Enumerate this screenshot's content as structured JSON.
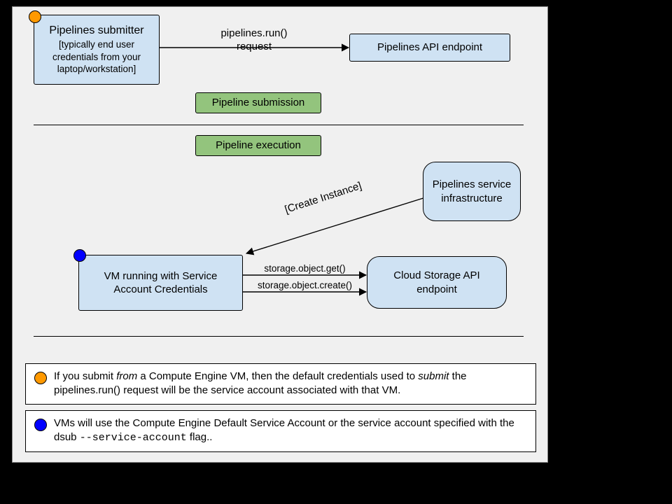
{
  "boxes": {
    "submitter_title": "Pipelines submitter",
    "submitter_sub": "[typically end user credentials from your laptop/workstation]",
    "api_endpoint": "Pipelines API endpoint",
    "vm": "VM running with Service Account Credentials",
    "storage": "Cloud Storage API endpoint",
    "service_infra": "Pipelines service infrastructure"
  },
  "phases": {
    "submission": "Pipeline submission",
    "execution": "Pipeline execution"
  },
  "edges": {
    "run_top": "pipelines.run()",
    "run_bot": "request",
    "create": "[Create Instance]",
    "get": "storage.object.get()",
    "create_obj": "storage.object.create()"
  },
  "notes": {
    "orange_a": "If you submit ",
    "orange_b": "from",
    "orange_c": " a Compute Engine VM, then the default credentials used to ",
    "orange_d": "submit",
    "orange_e": " the pipelines.run() request will be the service account associated with that VM.",
    "blue_a": "VMs will use the Compute Engine Default Service Account or the service account specified with the dsub ",
    "blue_b": "--service-account",
    "blue_c": " flag.."
  }
}
